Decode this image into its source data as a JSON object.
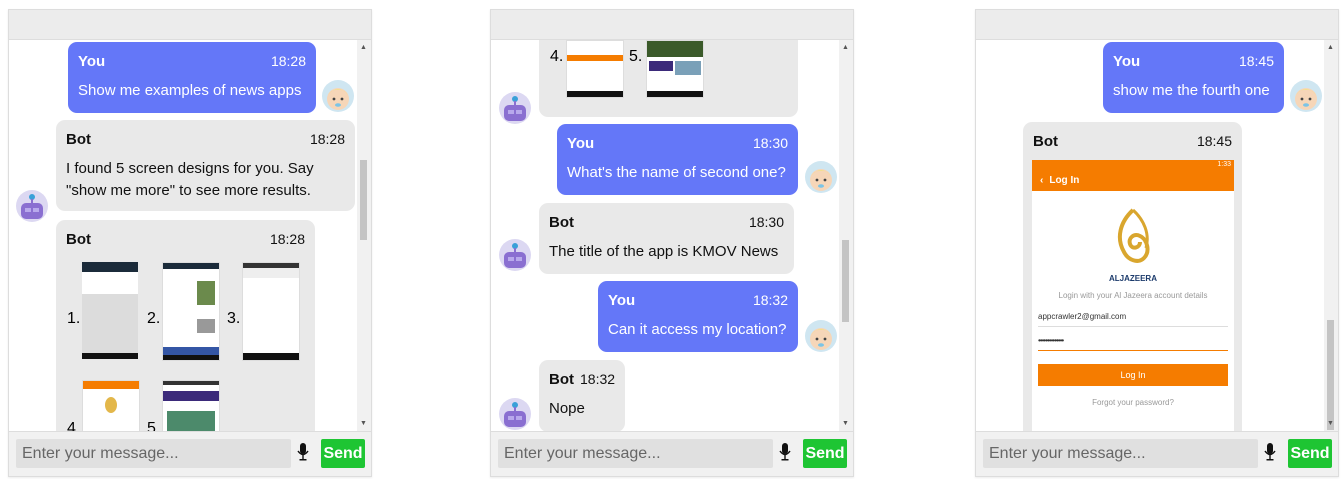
{
  "input": {
    "placeholder": "Enter your message...",
    "send_label": "Send"
  },
  "colors": {
    "you_bubble": "#6477f8",
    "bot_bubble": "#e9e9e9",
    "send": "#1ec533",
    "app_orange": "#f57c00"
  },
  "panel1": {
    "m1": {
      "sender": "You",
      "time": "18:28",
      "text": "Show me examples of news apps"
    },
    "m2": {
      "sender": "Bot",
      "time": "18:28",
      "text": "I found 5 screen designs for you. Say \"show me more\" to see more results."
    },
    "m3": {
      "sender": "Bot",
      "time": "18:28",
      "thumb_labels": [
        "1.",
        "2.",
        "3.",
        "4",
        "5"
      ]
    }
  },
  "panel2": {
    "thumb_labels": [
      "4.",
      "5."
    ],
    "m1": {
      "sender": "You",
      "time": "18:30",
      "text": "What's the name of second one?"
    },
    "m2": {
      "sender": "Bot",
      "time": "18:30",
      "text": "The title of the app is KMOV News"
    },
    "m3": {
      "sender": "You",
      "time": "18:32",
      "text": "Can it access my location?"
    },
    "m4": {
      "sender": "Bot",
      "time": "18:32",
      "text": "Nope"
    }
  },
  "panel3": {
    "m1": {
      "sender": "You",
      "time": "18:45",
      "text": "show me the fourth one"
    },
    "m2": {
      "sender": "Bot",
      "time": "18:45"
    },
    "app": {
      "status_time": "1:33",
      "title": "Log In",
      "brand": "ALJAZEERA",
      "subtitle": "Login with your Al Jazeera account details",
      "email": "appcrawler2@gmail.com",
      "password": "••••••••••••••",
      "login_button": "Log In",
      "forgot": "Forgot your password?"
    }
  }
}
